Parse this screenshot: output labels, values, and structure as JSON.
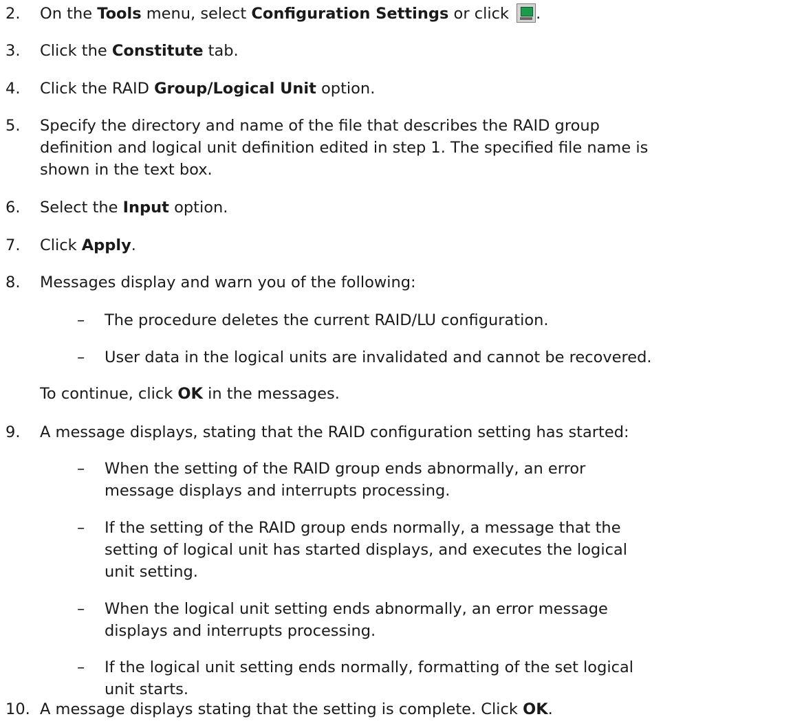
{
  "steps": [
    {
      "num": "2.",
      "parts": [
        "On the ",
        "Tools",
        " menu, select ",
        "Configuration Settings",
        " or click ",
        "."
      ]
    },
    {
      "num": "3.",
      "parts": [
        "Click the ",
        "Constitute",
        " tab."
      ]
    },
    {
      "num": "4.",
      "parts": [
        "Click the RAID ",
        "Group/Logical Unit",
        " option."
      ]
    },
    {
      "num": "5.",
      "lines": [
        "Specify the directory and name of the file that describes the RAID group",
        "definition and logical unit definition edited in step 1. The specified file name is",
        "shown in the text box."
      ]
    },
    {
      "num": "6.",
      "parts": [
        "Select the ",
        "Input",
        " option."
      ]
    },
    {
      "num": "7.",
      "parts": [
        "Click ",
        "Apply",
        "."
      ]
    },
    {
      "num": "8.",
      "text": "Messages display and warn you of the following:",
      "bullets": [
        "The procedure deletes the current RAID/LU configuration.",
        "User data in the logical units are invalidated and cannot be recovered."
      ],
      "after": [
        "To continue, click ",
        "OK",
        " in the messages."
      ]
    },
    {
      "num": "9.",
      "text": "A message displays, stating that the RAID configuration setting has started:",
      "bullets": [
        [
          "When the setting of the RAID group ends abnormally, an error",
          "message displays and interrupts processing."
        ],
        [
          "If the setting of the RAID group ends normally, a message that the",
          "setting of logical unit has started displays, and executes the logical",
          "unit setting."
        ],
        [
          "When the logical unit setting ends abnormally, an error message",
          "displays and interrupts processing."
        ],
        [
          "If the logical unit setting ends normally, formatting of the set logical",
          "unit starts."
        ]
      ]
    },
    {
      "num": "10.",
      "parts": [
        "A message displays stating that the setting is complete. Click ",
        "OK",
        "."
      ]
    }
  ],
  "dash": "–",
  "icons": {
    "configuration_settings": "configuration-settings-icon"
  },
  "colors": {
    "text": "#1a1a1a",
    "icon_screen": "#1d9a4c"
  }
}
